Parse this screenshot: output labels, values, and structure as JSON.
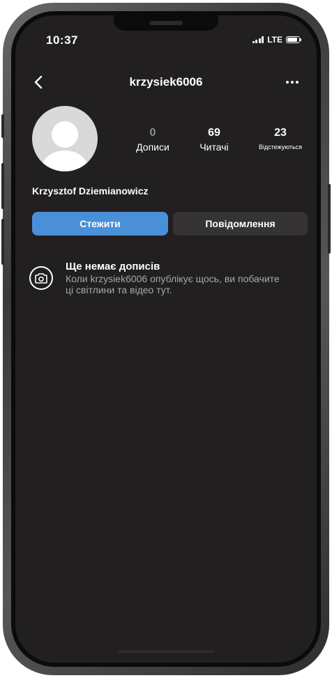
{
  "status_bar": {
    "time": "10:37",
    "network": "LTE",
    "battery_level": 0.85
  },
  "header": {
    "title": "krzysiek6006",
    "back_icon": "chevron-left-icon",
    "more_icon": "more-horizontal-icon"
  },
  "profile": {
    "full_name": "Krzysztof Dziemianowicz",
    "avatar_icon": "default-avatar-icon",
    "stats": {
      "posts_count": "0",
      "posts_label": "Дописи",
      "followers_count": "69",
      "followers_label": "Читачі",
      "following_count": "23",
      "following_label": "Відстежуються"
    }
  },
  "actions": {
    "follow_label": "Стежити",
    "message_label": "Повідомлення"
  },
  "empty_state": {
    "icon": "camera-icon",
    "title": "Ще немає дописів",
    "text": "Коли krzysiek6006 опублікує щось, ви побачите ці світлини та відео тут."
  },
  "colors": {
    "background": "#221f20",
    "follow_button": "#4a90d9",
    "message_button": "#363334"
  }
}
